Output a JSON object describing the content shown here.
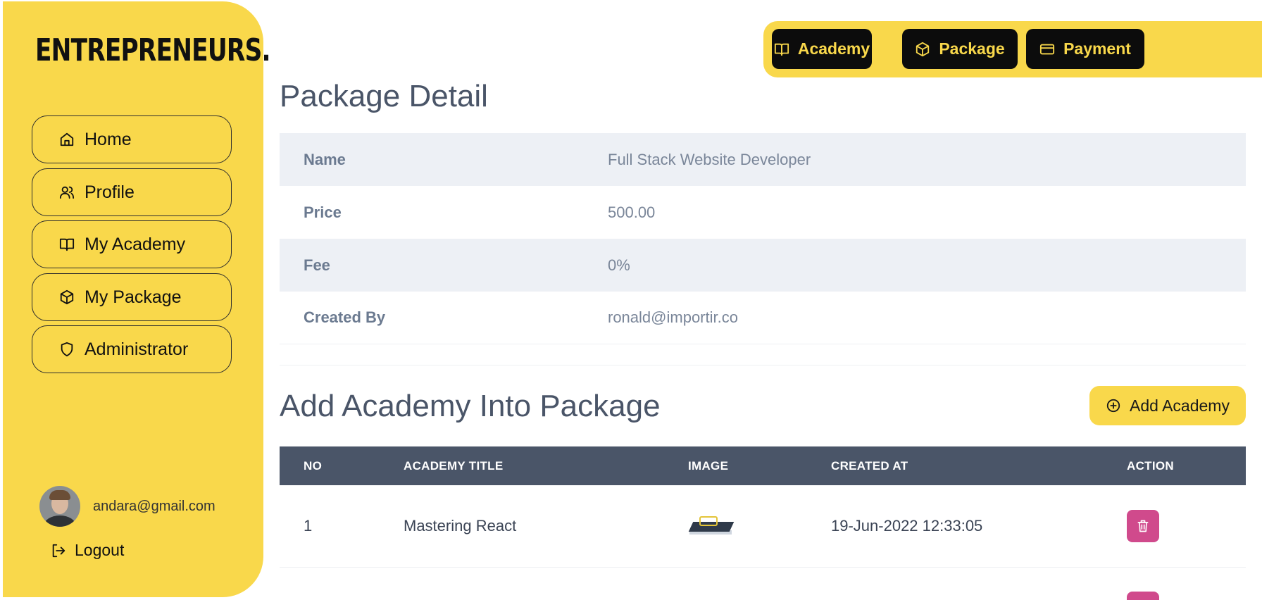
{
  "brand": "ENTREPRENEURS.",
  "sidebar": {
    "items": [
      {
        "label": "Home",
        "icon": "home-icon"
      },
      {
        "label": "Profile",
        "icon": "users-icon"
      },
      {
        "label": "My Academy",
        "icon": "book-icon"
      },
      {
        "label": "My Package",
        "icon": "package-icon"
      },
      {
        "label": "Administrator",
        "icon": "shield-icon"
      }
    ],
    "user_email": "andara@gmail.com",
    "logout_label": "Logout"
  },
  "topbar": {
    "buttons": [
      {
        "label": "Academy",
        "icon": "book-icon"
      },
      {
        "label": "Package",
        "icon": "package-icon"
      },
      {
        "label": "Payment",
        "icon": "credit-card-icon"
      }
    ]
  },
  "detail": {
    "title": "Package Detail",
    "rows": [
      {
        "key": "Name",
        "value": "Full Stack Website Developer"
      },
      {
        "key": "Price",
        "value": "500.00"
      },
      {
        "key": "Fee",
        "value": "0%"
      },
      {
        "key": "Created By",
        "value": "ronald@importir.co"
      }
    ]
  },
  "academy_section": {
    "title": "Add Academy Into Package",
    "add_button_label": "Add Academy",
    "table": {
      "headers": [
        "NO",
        "ACADEMY TITLE",
        "IMAGE",
        "CREATED AT",
        "ACTION"
      ],
      "rows": [
        {
          "no": "1",
          "title": "Mastering React",
          "created_at": "19-Jun-2022 12:33:05"
        }
      ]
    }
  },
  "colors": {
    "accent": "#f9d84b",
    "dark": "#0c0c0c",
    "table_header": "#4a5568",
    "delete": "#d04a8c"
  }
}
